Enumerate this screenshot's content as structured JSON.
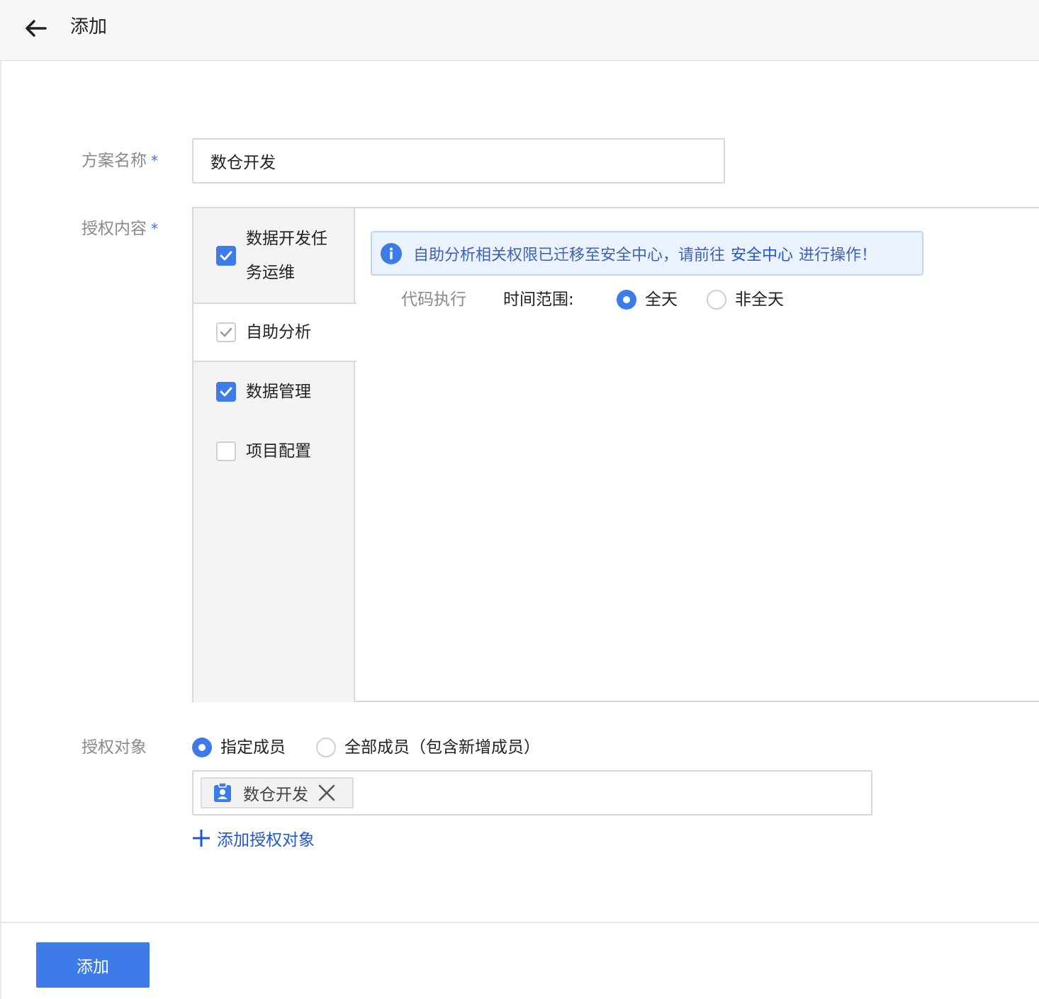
{
  "header": {
    "title": "添加"
  },
  "form": {
    "name": {
      "label": "方案名称",
      "required_mark": "*",
      "value": "数仓开发"
    },
    "content": {
      "label": "授权内容",
      "required_mark": "*",
      "categories": [
        {
          "label_line1": "数据开发任",
          "label_line2": "务运维",
          "checked": true
        },
        {
          "label": "自助分析",
          "checked": true
        },
        {
          "label": "数据管理",
          "checked": true
        },
        {
          "label": "项目配置",
          "checked": false
        }
      ],
      "notice": {
        "text_before": "自助分析相关权限已迁移至安全中心，请前往",
        "link": "安全中心",
        "text_after": "进行操作！"
      },
      "code_exec_label": "代码执行",
      "time_range_label": "时间范围:",
      "time_options": [
        {
          "label": "全天",
          "selected": true
        },
        {
          "label": "非全天",
          "selected": false
        }
      ]
    },
    "object": {
      "label": "授权对象",
      "options": [
        {
          "label": "指定成员",
          "selected": true
        },
        {
          "label": "全部成员（包含新增成员）",
          "selected": false
        }
      ],
      "tags": [
        {
          "label": "数仓开发"
        }
      ],
      "add_label": "添加授权对象"
    }
  },
  "footer": {
    "submit_label": "添加"
  },
  "colors": {
    "accent": "#3c7be8",
    "link": "#1f55d6",
    "notice_bg": "#eaf2fd"
  }
}
